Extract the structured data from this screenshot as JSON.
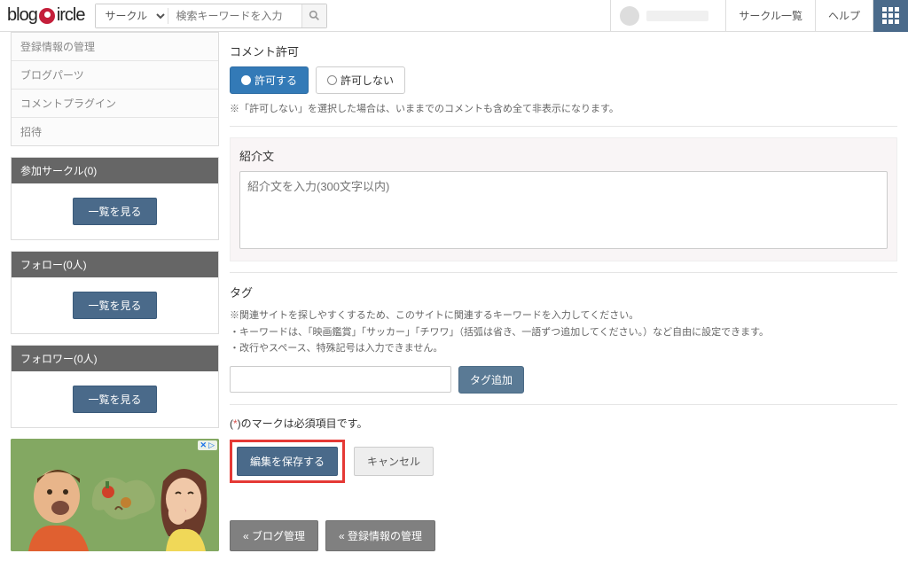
{
  "search": {
    "select_label": "サークル",
    "placeholder": "検索キーワードを入力"
  },
  "topnav": {
    "circle_list": "サークル一覧",
    "help": "ヘルプ"
  },
  "sidebar_menu": [
    "登録情報の管理",
    "ブログパーツ",
    "コメントプラグイン",
    "招待"
  ],
  "panel_join": {
    "title": "参加サークル(0)",
    "button": "一覧を見る"
  },
  "panel_follow": {
    "title": "フォロー(0人)",
    "button": "一覧を見る"
  },
  "panel_follower": {
    "title": "フォロワー(0人)",
    "button": "一覧を見る"
  },
  "comment_perm": {
    "label": "コメント許可",
    "allow": "許可する",
    "deny": "許可しない",
    "note": "※「許可しない」を選択した場合は、いままでのコメントも含め全て非表示になります。"
  },
  "intro": {
    "label": "紹介文",
    "placeholder": "紹介文を入力(300文字以内)"
  },
  "tag": {
    "label": "タグ",
    "note1": "※関連サイトを探しやすくするため、このサイトに関連するキーワードを入力してください。",
    "note2": "・キーワードは、「映画鑑賞」「サッカー」「チワワ」（括弧は省き、一語ずつ追加してください。）など自由に設定できます。",
    "note3": "・改行やスペース、特殊記号は入力できません。",
    "add_button": "タグ追加"
  },
  "required_note_prefix": "(",
  "required_note_ast": "*",
  "required_note_suffix": ")のマークは必須項目です。",
  "buttons": {
    "save": "編集を保存する",
    "cancel": "キャンセル",
    "back_blog": "« ブログ管理",
    "back_reg": "« 登録情報の管理"
  }
}
